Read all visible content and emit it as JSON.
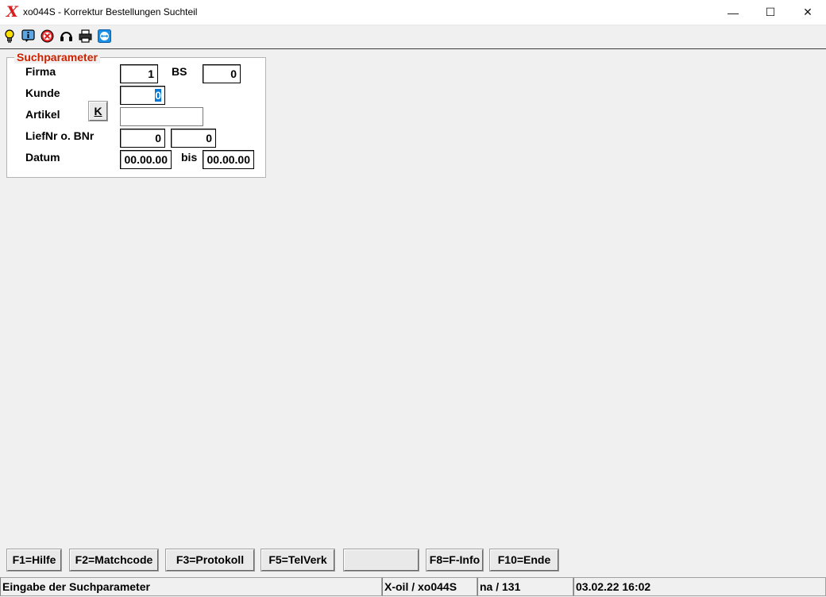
{
  "window": {
    "title": "xo044S - Korrektur Bestellungen Suchteil",
    "logo": "X",
    "minimize": "—",
    "maximize": "☐",
    "close": "✕"
  },
  "toolbar": {
    "icons": [
      "lightbulb-icon",
      "info-icon",
      "stop-icon",
      "headset-icon",
      "printer-icon",
      "teamviewer-icon"
    ]
  },
  "form": {
    "legend": "Suchparameter",
    "labels": {
      "firma": "Firma",
      "bs": "BS",
      "kunde": "Kunde",
      "artikel": "Artikel",
      "liefnr": "LiefNr o. BNr",
      "datum": "Datum",
      "bis": "bis"
    },
    "values": {
      "firma": "1",
      "bs": "0",
      "kunde": "0",
      "artikel": "",
      "liefnr": "0",
      "bnr": "0",
      "datum_von": "00.00.00",
      "datum_bis": "00.00.00"
    },
    "k_button": "K"
  },
  "function_keys": {
    "f1": "F1=Hilfe",
    "f2": "F2=Matchcode",
    "f3": "F3=Protokoll",
    "f5": "F5=TelVerk",
    "f6": "",
    "f8": "F8=F-Info",
    "f10": "F10=Ende"
  },
  "statusbar": {
    "message": "Eingabe der Suchparameter",
    "program": "X-oil / xo044S",
    "user": "na / 131",
    "datetime": "03.02.22 16:02"
  },
  "colors": {
    "accent_red": "#cc2200",
    "selection_blue": "#0078d7"
  }
}
